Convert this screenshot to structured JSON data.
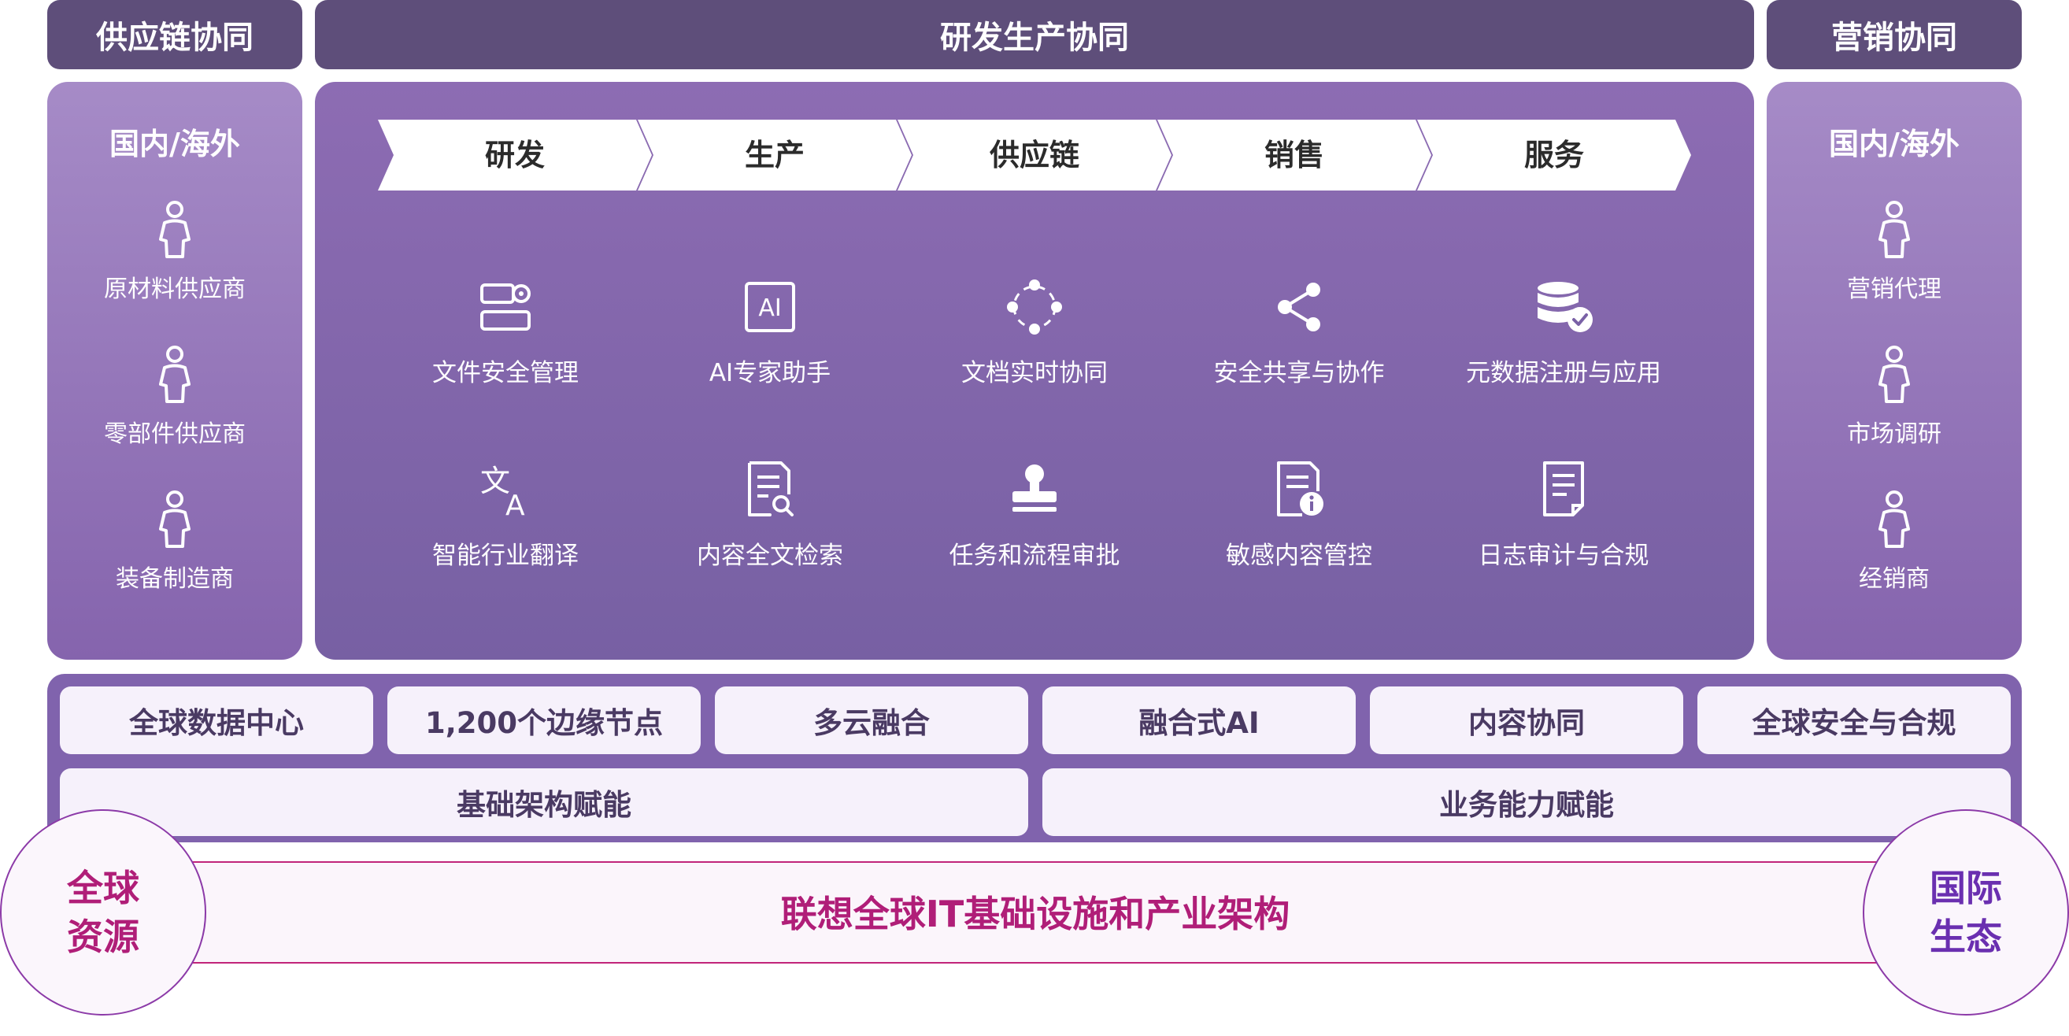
{
  "headers": {
    "supply_chain": "供应链协同",
    "rnd_production": "研发生产协同",
    "marketing": "营销协同"
  },
  "left_panel": {
    "title": "国内/海外",
    "items": [
      "原材料供应商",
      "零部件供应商",
      "装备制造商"
    ]
  },
  "right_panel": {
    "title": "国内/海外",
    "items": [
      "营销代理",
      "市场调研",
      "经销商"
    ]
  },
  "stages": [
    "研发",
    "生产",
    "供应链",
    "销售",
    "服务"
  ],
  "features_row1": [
    {
      "label": "文件安全管理",
      "icon": "file-security-icon"
    },
    {
      "label": "AI专家助手",
      "icon": "ai-assistant-icon"
    },
    {
      "label": "文档实时协同",
      "icon": "realtime-collab-icon"
    },
    {
      "label": "安全共享与协作",
      "icon": "share-icon"
    },
    {
      "label": "元数据注册与应用",
      "icon": "database-check-icon"
    }
  ],
  "features_row2": [
    {
      "label": "智能行业翻译",
      "icon": "translate-icon"
    },
    {
      "label": "内容全文检索",
      "icon": "document-search-icon"
    },
    {
      "label": "任务和流程审批",
      "icon": "approval-stamp-icon"
    },
    {
      "label": "敏感内容管控",
      "icon": "sensitive-content-icon"
    },
    {
      "label": "日志审计与合规",
      "icon": "audit-log-icon"
    }
  ],
  "platform": {
    "chips": [
      "全球数据中心",
      "1,200个边缘节点",
      "多云融合",
      "融合式AI",
      "内容协同",
      "全球安全与合规"
    ],
    "enablement": [
      "基础架构赋能",
      "业务能力赋能"
    ]
  },
  "foundation": {
    "title": "联想全球IT基础设施和产业架构",
    "left_circle": [
      "全球",
      "资源"
    ],
    "right_circle": [
      "国际",
      "生态"
    ]
  },
  "colors": {
    "header_bg": "#5e4e7a",
    "panel_purple": "#8564ad",
    "accent_magenta": "#b01e78",
    "accent_violet": "#6a2fb0"
  },
  "icons": {
    "person": "person-outline-icon"
  }
}
